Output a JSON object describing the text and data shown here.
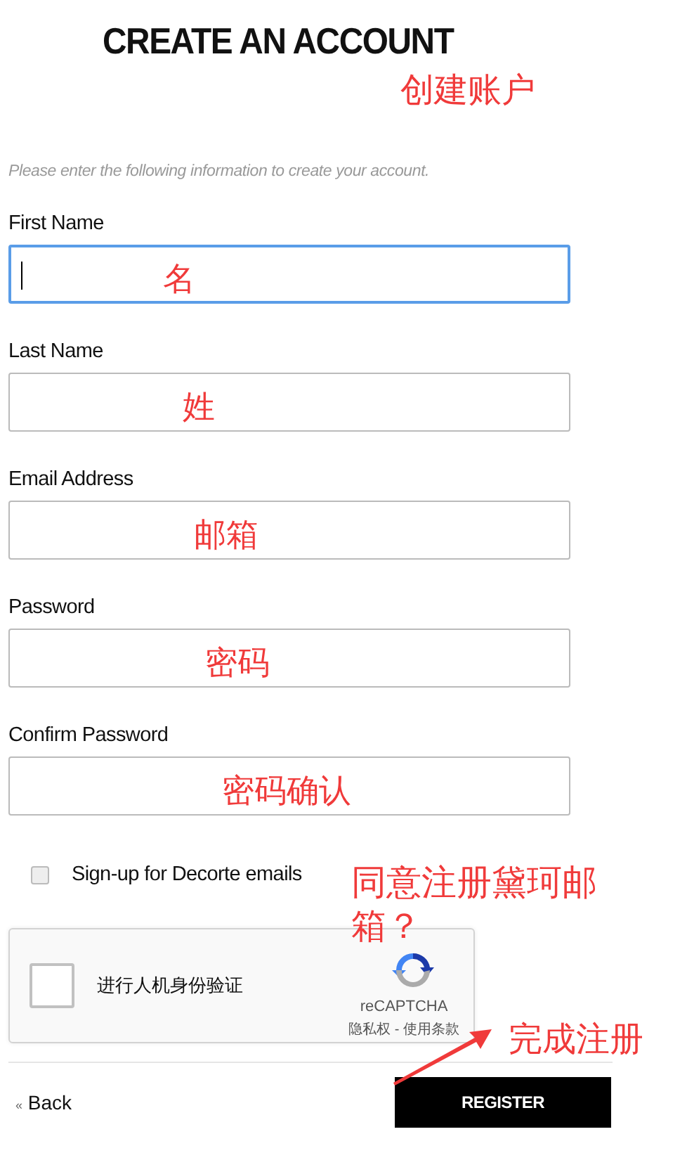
{
  "title": "CREATE AN ACCOUNT",
  "title_note": "创建账户",
  "intro": "Please enter the following information to create your account.",
  "fields": [
    {
      "label": "First Name",
      "note": "名",
      "focused": true
    },
    {
      "label": "Last Name",
      "note": "姓",
      "focused": false
    },
    {
      "label": "Email Address",
      "note": "邮箱",
      "focused": false
    },
    {
      "label": "Password",
      "note": "密码",
      "focused": false
    },
    {
      "label": "Confirm Password",
      "note": "密码确认",
      "focused": false
    }
  ],
  "newsletter": {
    "label": "Sign-up for Decorte emails",
    "checked": false,
    "note": "同意注册黛珂邮箱？"
  },
  "captcha": {
    "label": "进行人机身份验证",
    "checked": false,
    "brand": "reCAPTCHA",
    "links": "隐私权 - 使用条款"
  },
  "back": {
    "icon": "«",
    "label": "Back"
  },
  "register": {
    "label": "REGISTER",
    "note": "完成注册"
  }
}
